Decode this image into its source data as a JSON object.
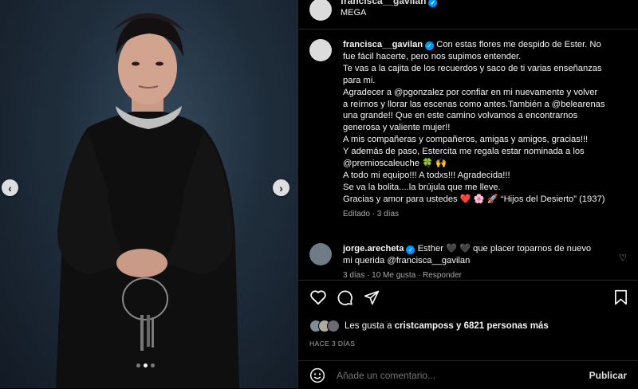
{
  "post": {
    "header_username": "francisca__gavilan",
    "header_subtitle": "MEGA",
    "carousel_dots": 3,
    "carousel_active": 1
  },
  "caption": {
    "username": "francisca__gavilan",
    "lines": [
      "Con estas flores me despido de Ester. No",
      "fue fácil hacerte, pero nos supimos entender.",
      "Te vas a la cajita de los recuerdos y saco de ti varias enseñanzas",
      "para mi.",
      "Agradecer a @pgonzalez por confiar en mi nuevamente y volver",
      "a reírnos y llorar las escenas como antes.También a @belearenas",
      "una grande!! Que en este camino volvamos a encontrarnos",
      "generosa y valiente mujer!!",
      "A mis compañeras y compañeros, amigas y amigos, gracias!!!",
      "Y además de paso, Estercita me regala estar nominada a los",
      "@premioscaleuche 🍀 🙌",
      "A todo mi equipo!!! A todxs!!! Agradecida!!!",
      "Se va la bolita....la brújula que me lleve.",
      "Gracias y amor para ustedes ❤️ 🌸 🚀 “Hijos del Desierto” (1937)"
    ],
    "meta": "Editado · 3 días"
  },
  "comment": {
    "username": "jorge.arecheta",
    "text_line1": "Esther 🖤 🖤 que placer toparnos de nuevo",
    "text_line2": "mi querida @francisca__gavilan",
    "meta": "3 días · 10 Me gusta · Responder"
  },
  "actions": {
    "icons": [
      "heart-icon",
      "comment-icon",
      "share-icon",
      "bookmark-icon"
    ]
  },
  "likes": {
    "prefix": "Les gusta a ",
    "user": "cristcamposs",
    "suffix": " y 6821 personas más"
  },
  "date_label": "HACE 3 DÍAS",
  "add_comment": {
    "placeholder": "Añade un comentario...",
    "publish_label": "Publicar"
  },
  "colors": {
    "background": "#000000",
    "verified": "#0095f6",
    "muted": "#a8a8a8"
  }
}
